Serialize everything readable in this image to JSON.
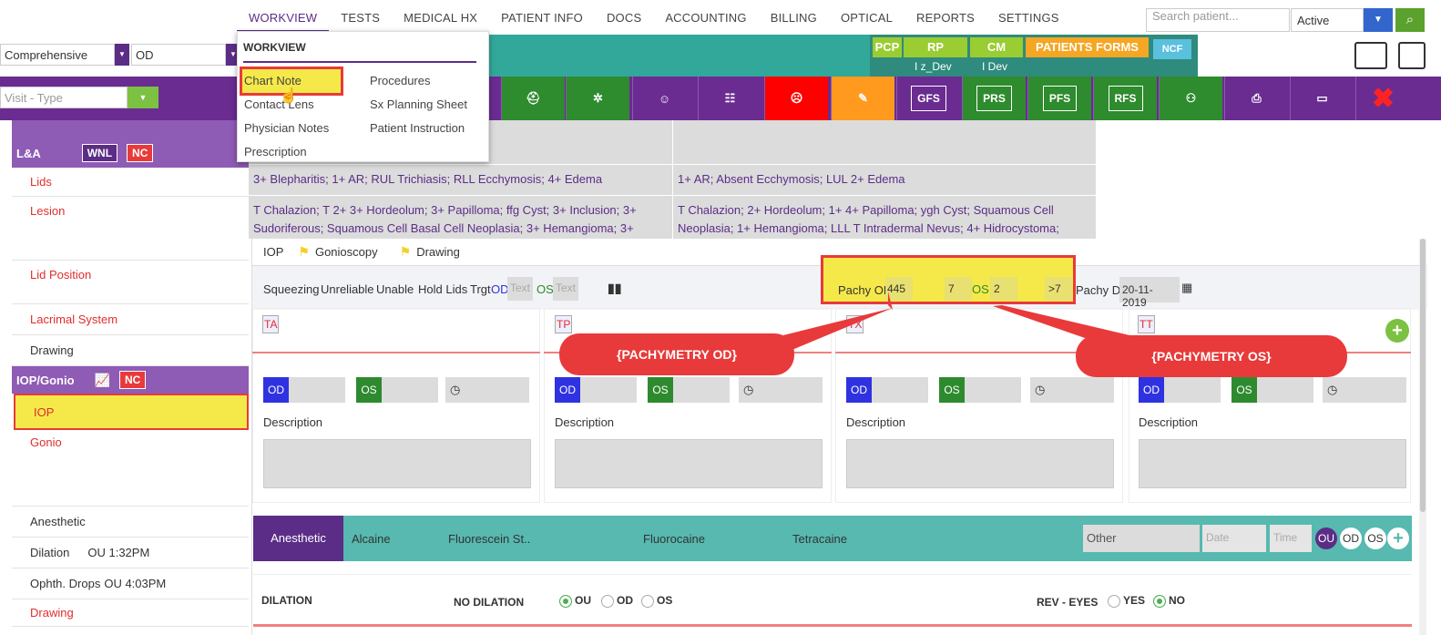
{
  "nav": {
    "items": [
      "WORKVIEW",
      "TESTS",
      "MEDICAL HX",
      "PATIENT INFO",
      "DOCS",
      "ACCOUNTING",
      "BILLING",
      "OPTICAL",
      "REPORTS",
      "SETTINGS"
    ]
  },
  "search": {
    "placeholder": "Search patient...",
    "status": "Active"
  },
  "toolbar": {
    "exam_type": "Comprehensive",
    "eye": "OD",
    "visit_type_placeholder": "Visit - Type"
  },
  "badges": {
    "pcp": "PCP",
    "rp": "RP",
    "cm": "CM",
    "forms": "PATIENTS FORMS",
    "ncf": "NCF",
    "rp_user": "I z_Dev",
    "cm_user": "I Dev"
  },
  "icon_buttons": [
    "GFS",
    "PRS",
    "PFS",
    "RFS"
  ],
  "menu": {
    "header": "WORKVIEW",
    "left": [
      "Chart Note",
      "Contact Lens",
      "Physician Notes",
      "Prescription"
    ],
    "right": [
      "Procedures",
      "Sx Planning Sheet",
      "Patient Instruction"
    ]
  },
  "sidebar": {
    "la_title": "L&A",
    "wnl": "WNL",
    "nc": "NC",
    "items": [
      "Lids",
      "Lesion",
      "Lid Position",
      "Lacrimal System",
      "Drawing"
    ],
    "iop_title": "IOP/Gonio",
    "iop_nc": "NC",
    "iop_items": [
      "IOP",
      "Gonio"
    ],
    "anesthetic": "Anesthetic",
    "dilation_label": "Dilation",
    "dilation_val": "OU 1:32PM",
    "drops_label": "Ophth. Drops",
    "drops_val": "OU 4:03PM",
    "drawing2": "Drawing"
  },
  "findings": {
    "od_lids": "3+ Blepharitis; 1+ AR; RUL Trichiasis; RLL Ecchymosis; 4+ Edema",
    "os_lids": "1+ AR; Absent Ecchymosis; LUL 2+ Edema",
    "od_lesion": "T Chalazion; T 2+ 3+ Hordeolum; 3+ Papilloma; ffg Cyst; 3+ Inclusion; 3+ Sudoriferous; Squamous Cell Basal Cell Neoplasia; 3+ Hemangioma; 3+",
    "os_lesion": "T Chalazion; 2+ Hordeolum; 1+ 4+ Papilloma; ygh Cyst; Squamous Cell Neoplasia; 1+ Hemangioma; LLL T Intradermal Nevus; 4+ Hidrocystoma;"
  },
  "iop": {
    "tabs": [
      "IOP",
      "Gonioscopy",
      "Drawing"
    ],
    "options": [
      "Squeezing",
      "Unreliable",
      "Unable",
      "Hold Lids"
    ],
    "trgt": "Trgt",
    "od": "OD",
    "os": "OS",
    "text_ph": "Text",
    "pachy_od_label": "Pachy OD",
    "pachy_od": "445",
    "pachy_od2": "7",
    "pachy_os_label": "OS",
    "pachy_os": "2",
    "pachy_os2": ">7",
    "pachy_dt_label": "Pachy Dt:",
    "pachy_dt": "20-11-2019",
    "method_labels": [
      "TA",
      "TP",
      "TX",
      "TT"
    ],
    "description": "Description"
  },
  "callouts": {
    "od": "{PACHYMETRY OD}",
    "os": "{PACHYMETRY OS}"
  },
  "anesthetic_bar": {
    "title": "Anesthetic",
    "items": [
      "Alcaine",
      "Fluorescein St..",
      "Fluorocaine",
      "Tetracaine"
    ],
    "other": "Other",
    "date": "Date",
    "time": "Time",
    "ou": "OU",
    "od": "OD",
    "os": "OS"
  },
  "dilation": {
    "title": "DILATION",
    "no_dilation": "NO DILATION",
    "ou": "OU",
    "od": "OD",
    "os": "OS",
    "rev": "REV - EYES",
    "yes": "YES",
    "no": "NO"
  }
}
